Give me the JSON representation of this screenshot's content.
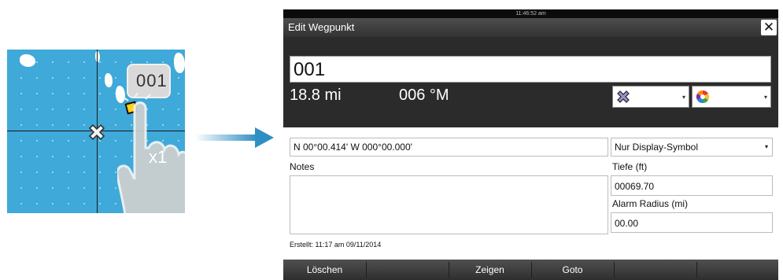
{
  "illustration": {
    "popup_text": "001",
    "tap_label": "x1"
  },
  "device": {
    "status_time": "11:46:52 am",
    "dialog_title": "Edit Wegpunkt",
    "close_symbol": "✕",
    "waypoint_name": "001",
    "distance": "18.8 mi",
    "bearing": "006 °M",
    "symbol_icon": "waypoint-cross-icon",
    "color_icon": "color-wheel-icon",
    "coordinates": "N 00°00.414'  W 000°00.000'",
    "display_mode": "Nur Display-Symbol",
    "notes_label": "Notes",
    "notes_value": "",
    "depth_label": "Tiefe (ft)",
    "depth_value": "00069.70",
    "alarm_label": "Alarm Radius (mi)",
    "alarm_value": "00.00",
    "created": "Erstellt: 11:17 am  09/11/2014",
    "buttons": {
      "delete": "Löschen",
      "show": "Zeigen",
      "goto": "Goto"
    }
  },
  "colors": {
    "map_water": "#3fa9d9",
    "arrow": "#2f8fc4",
    "dialog_dark": "#2b2b2b"
  }
}
